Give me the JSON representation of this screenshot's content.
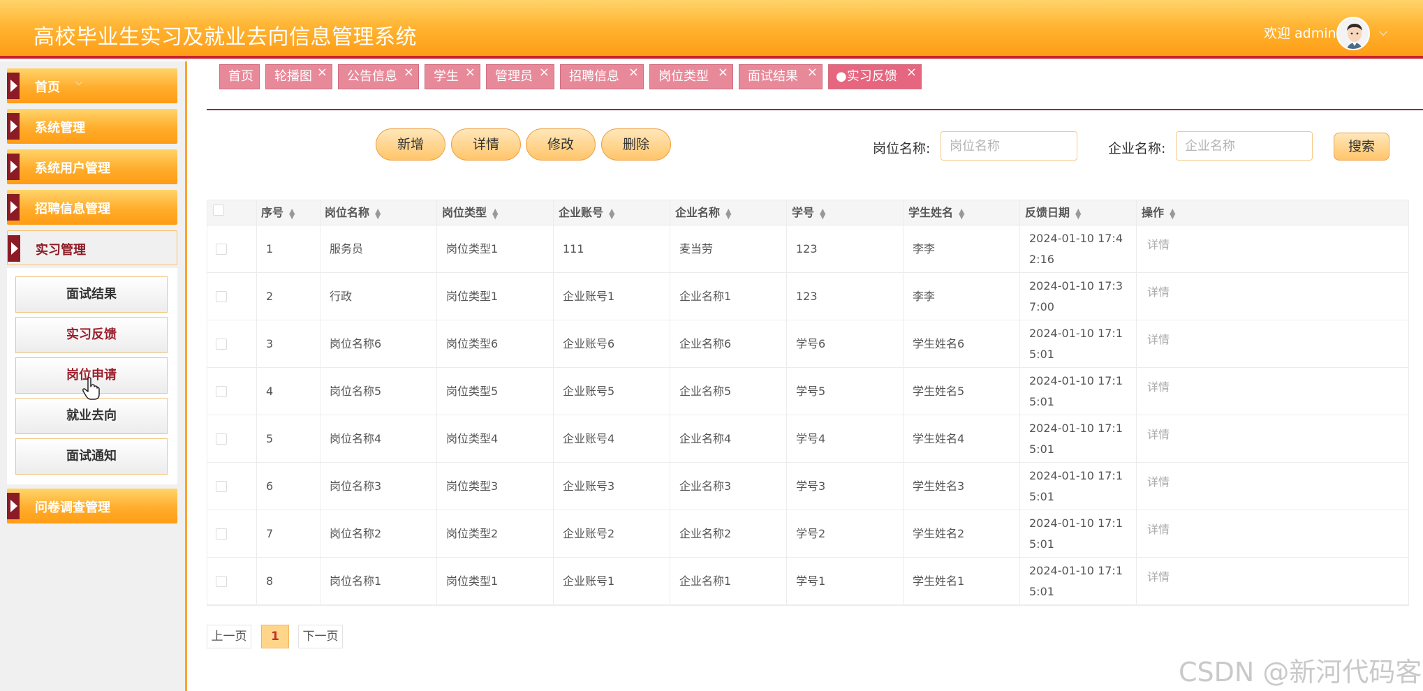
{
  "header": {
    "title": "高校毕业生实习及就业去向信息管理系统",
    "welcome": "欢迎 admin",
    "caret": "⌵"
  },
  "sidebar": {
    "items": [
      {
        "label": "首页",
        "chevron": "⌵"
      },
      {
        "label": "系统管理"
      },
      {
        "label": "系统用户管理"
      },
      {
        "label": "招聘信息管理"
      },
      {
        "label": "实习管理"
      },
      {
        "label": "问卷调查管理"
      }
    ],
    "submenu": [
      "面试结果",
      "实习反馈",
      "岗位申请",
      "就业去向",
      "面试通知"
    ]
  },
  "tabs": [
    {
      "label": "首页"
    },
    {
      "label": "轮播图"
    },
    {
      "label": "公告信息"
    },
    {
      "label": "学生"
    },
    {
      "label": "管理员"
    },
    {
      "label": "招聘信息"
    },
    {
      "label": "岗位类型"
    },
    {
      "label": "面试结果"
    },
    {
      "label": "●实习反馈"
    }
  ],
  "tab_close": "×",
  "toolbar": {
    "add": "新增",
    "detail": "详情",
    "edit": "修改",
    "delete": "删除",
    "search": "搜索"
  },
  "filters": {
    "job_label": "岗位名称:",
    "job_placeholder": "岗位名称",
    "company_label": "企业名称:",
    "company_placeholder": "企业名称"
  },
  "table": {
    "columns": [
      "序号",
      "岗位名称",
      "岗位类型",
      "企业账号",
      "企业名称",
      "学号",
      "学生姓名",
      "反馈日期",
      "操作"
    ],
    "rows": [
      [
        "1",
        "服务员",
        "岗位类型1",
        "111",
        "麦当劳",
        "123",
        "李李",
        "2024-01-10 17:42:16",
        "详情"
      ],
      [
        "2",
        "行政",
        "岗位类型1",
        "企业账号1",
        "企业名称1",
        "123",
        "李李",
        "2024-01-10 17:37:00",
        "详情"
      ],
      [
        "3",
        "岗位名称6",
        "岗位类型6",
        "企业账号6",
        "企业名称6",
        "学号6",
        "学生姓名6",
        "2024-01-10 17:15:01",
        "详情"
      ],
      [
        "4",
        "岗位名称5",
        "岗位类型5",
        "企业账号5",
        "企业名称5",
        "学号5",
        "学生姓名5",
        "2024-01-10 17:15:01",
        "详情"
      ],
      [
        "5",
        "岗位名称4",
        "岗位类型4",
        "企业账号4",
        "企业名称4",
        "学号4",
        "学生姓名4",
        "2024-01-10 17:15:01",
        "详情"
      ],
      [
        "6",
        "岗位名称3",
        "岗位类型3",
        "企业账号3",
        "企业名称3",
        "学号3",
        "学生姓名3",
        "2024-01-10 17:15:01",
        "详情"
      ],
      [
        "7",
        "岗位名称2",
        "岗位类型2",
        "企业账号2",
        "企业名称2",
        "学号2",
        "学生姓名2",
        "2024-01-10 17:15:01",
        "详情"
      ],
      [
        "8",
        "岗位名称1",
        "岗位类型1",
        "企业账号1",
        "企业名称1",
        "学号1",
        "学生姓名1",
        "2024-01-10 17:15:01",
        "详情"
      ]
    ]
  },
  "pagination": {
    "prev": "上一页",
    "current": "1",
    "next": "下一页"
  },
  "watermark": "CSDN @新河代码客"
}
